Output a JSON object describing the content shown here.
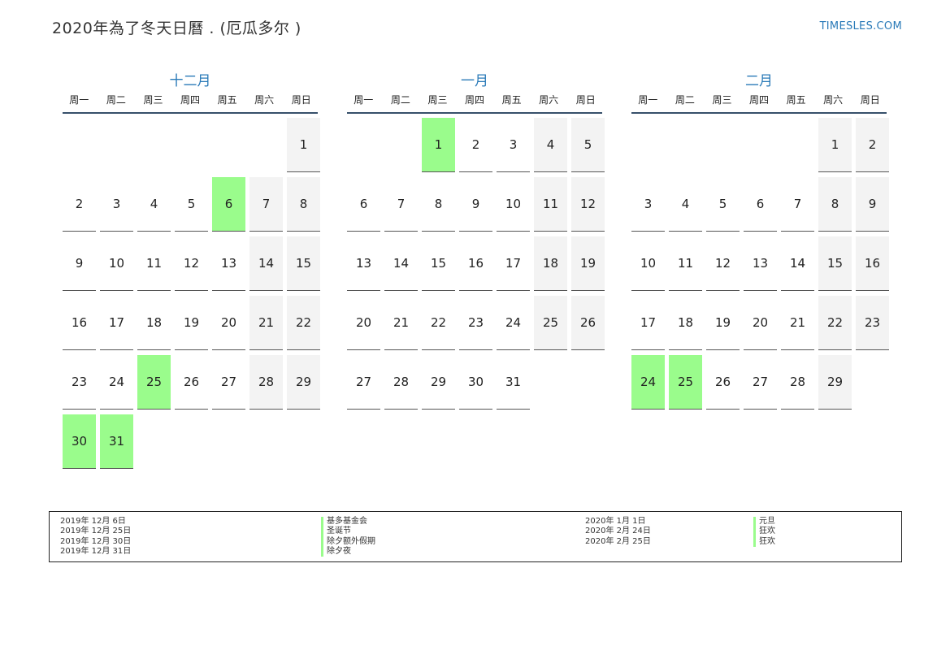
{
  "title": "2020年為了冬天日曆 . (厄瓜多尔 )",
  "site": "TIMESLES.COM",
  "weekdays": [
    "周一",
    "周二",
    "周三",
    "周四",
    "周五",
    "周六",
    "周日"
  ],
  "months": [
    {
      "name": "十二月",
      "first_col": 6,
      "days_in_month": 31,
      "holidays": [
        6,
        25,
        30,
        31
      ]
    },
    {
      "name": "一月",
      "first_col": 2,
      "days_in_month": 31,
      "holidays": [
        1
      ]
    },
    {
      "name": "二月",
      "first_col": 5,
      "days_in_month": 29,
      "holidays": [
        24,
        25
      ]
    }
  ],
  "legend": {
    "left": [
      {
        "date": "2019年 12月 6日",
        "name": "基多基金会"
      },
      {
        "date": "2019年 12月 25日",
        "name": "圣诞节"
      },
      {
        "date": "2019年 12月 30日",
        "name": "除夕额外假期"
      },
      {
        "date": "2019年 12月 31日",
        "name": "除夕夜"
      }
    ],
    "right": [
      {
        "date": "2020年 1月 1日",
        "name": "元旦"
      },
      {
        "date": "2020年 2月 24日",
        "name": "狂欢"
      },
      {
        "date": "2020年 2月 25日",
        "name": "狂欢"
      }
    ]
  },
  "colors": {
    "holiday": "#9afc8c",
    "weekend": "#f3f3f3",
    "accent": "#2a7ab8"
  }
}
